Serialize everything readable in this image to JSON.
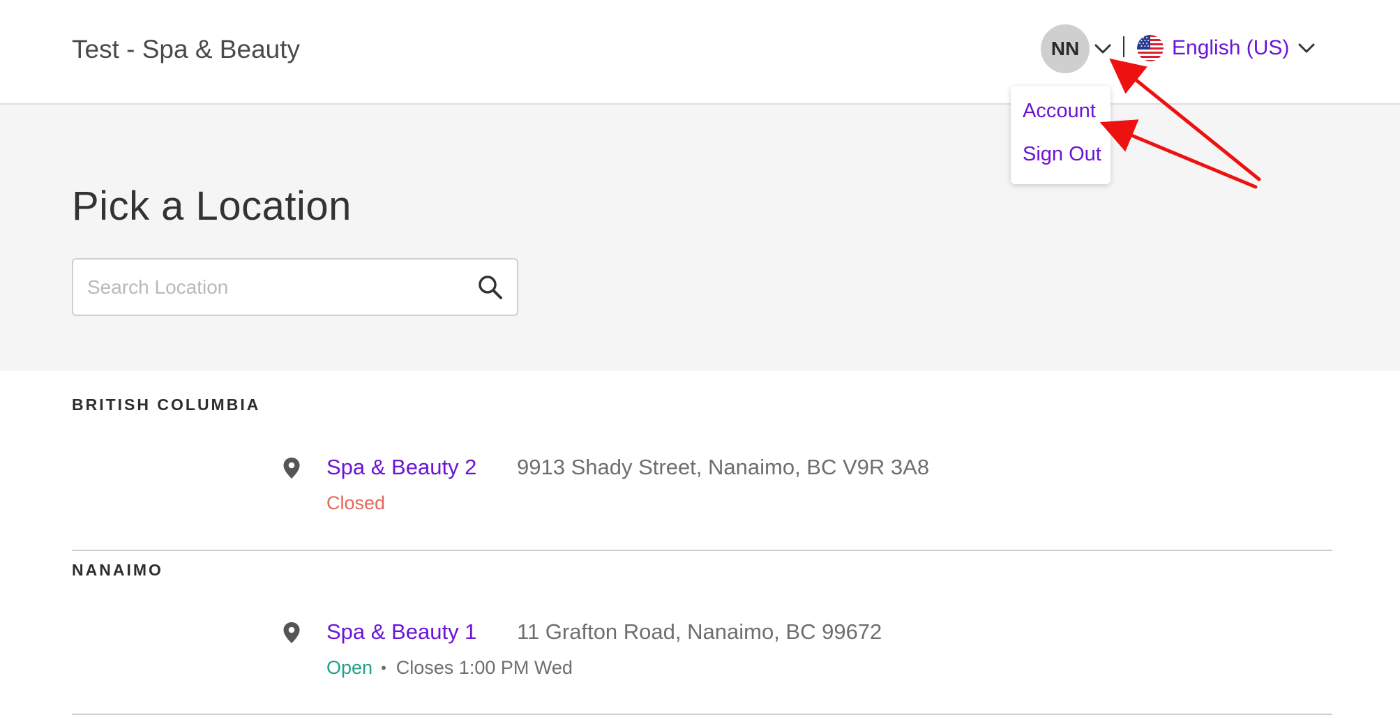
{
  "header": {
    "business_name": "Test - Spa & Beauty",
    "avatar_initials": "NN",
    "language_label": "English (US)"
  },
  "account_menu": {
    "items": [
      {
        "label": "Account"
      },
      {
        "label": "Sign Out"
      }
    ]
  },
  "hero": {
    "title": "Pick a Location",
    "search_placeholder": "Search Location",
    "search_value": ""
  },
  "regions": [
    {
      "name": "BRITISH COLUMBIA",
      "locations": [
        {
          "name": "Spa & Beauty 2",
          "address": "9913 Shady Street, Nanaimo, BC V9R 3A8",
          "status": "Closed",
          "hours": ""
        }
      ]
    },
    {
      "name": "NANAIMO",
      "locations": [
        {
          "name": "Spa & Beauty 1",
          "address": "11 Grafton Road, Nanaimo, BC 99672",
          "status": "Open",
          "hours": "Closes 1:00 PM Wed"
        }
      ]
    }
  ],
  "colors": {
    "link_purple": "#6a14d6",
    "status_closed": "#e5665c",
    "status_open": "#1fa08a",
    "annotation_arrow": "#ee1111"
  },
  "icons": {
    "avatar_dropdown": "chevron-down-icon",
    "language_flag": "us-flag-icon",
    "language_dropdown": "chevron-down-icon",
    "search": "search-icon",
    "location_marker": "map-pin-icon"
  }
}
